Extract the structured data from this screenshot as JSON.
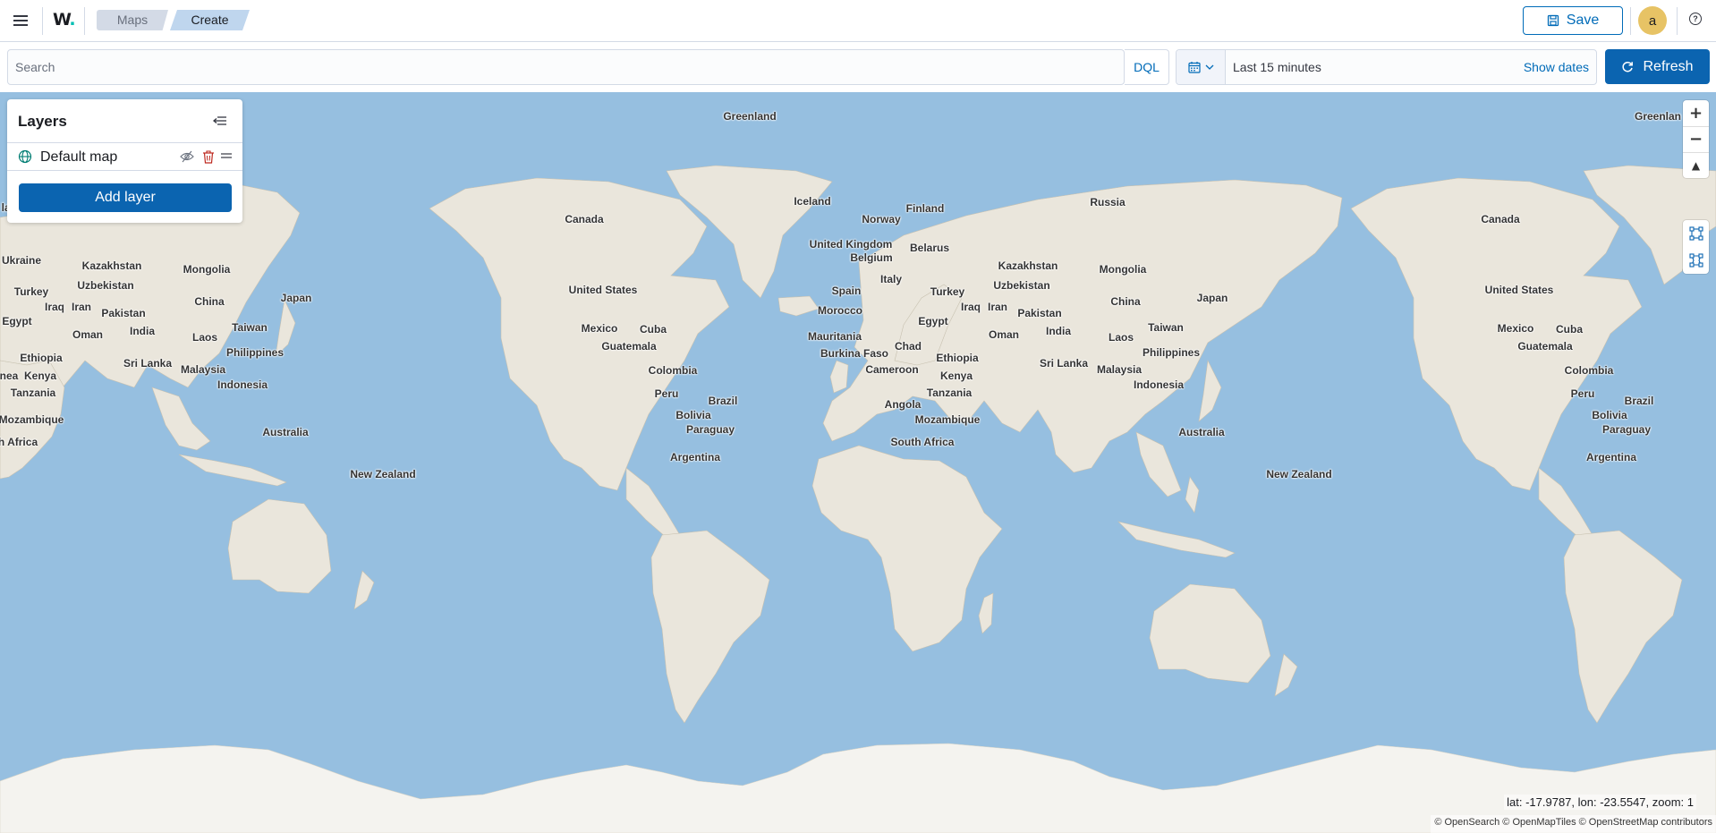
{
  "header": {
    "logo_text": "W",
    "logo_dot": ".",
    "breadcrumbs": [
      {
        "label": "Maps"
      },
      {
        "label": "Create"
      }
    ],
    "save_label": "Save",
    "avatar_initial": "a",
    "help_glyph": "?"
  },
  "query": {
    "search_placeholder": "Search",
    "language_label": "DQL",
    "time_range": "Last 15 minutes",
    "show_dates_label": "Show dates",
    "refresh_label": "Refresh"
  },
  "layers_panel": {
    "title": "Layers",
    "layers": [
      {
        "name": "Default map"
      }
    ],
    "add_layer_label": "Add layer"
  },
  "map": {
    "labels": [
      "Greenland",
      "Greenlan",
      "Iceland",
      "Norway",
      "Finland",
      "Russia",
      "Russia",
      "Canada",
      "Canada",
      "United Kingdom",
      "Belarus",
      "Belgium",
      "Kazakhstan",
      "Kazakhstan",
      "Mongolia",
      "Mongolia",
      "Ukraine",
      "Uzbekistan",
      "Uzbekistan",
      "Turkey",
      "Turkey",
      "Spain",
      "Italy",
      "United States",
      "United States",
      "Japan",
      "Japan",
      "China",
      "China",
      "Iraq",
      "Iraq",
      "Iran",
      "Iran",
      "Pakistan",
      "Pakistan",
      "Egypt",
      "Egypt",
      "Oman",
      "Oman",
      "India",
      "India",
      "Laos",
      "Laos",
      "Taiwan",
      "Taiwan",
      "Morocco",
      "Mauritania",
      "Mexico",
      "Mexico",
      "Cuba",
      "Cuba",
      "Guatemala",
      "Guatemala",
      "Chad",
      "Burkina Faso",
      "Ethiopia",
      "Ethiopia",
      "Philippines",
      "Philippines",
      "Sri Lanka",
      "Sri Lanka",
      "Malaysia",
      "Malaysia",
      "Cameroon",
      "Colombia",
      "Colombia",
      "Kenya",
      "Kenya",
      "Indonesia",
      "Indonesia",
      "Peru",
      "Peru",
      "Brazil",
      "Brazil",
      "Tanzania",
      "Tanzania",
      "Angola",
      "Bolivia",
      "Bolivia",
      "Mozambique",
      "Mozambique",
      "Paraguay",
      "Paraguay",
      "Australia",
      "Australia",
      "South Africa",
      "h Africa",
      "Argentina",
      "Argentina",
      "New Zealand",
      "New Zealand",
      "land",
      "nea"
    ],
    "coordinates_readout": "lat: -17.9787, lon: -23.5547, zoom: 1",
    "attribution": "© OpenSearch © OpenMapTiles © OpenStreetMap contributors",
    "zoom_in_glyph": "+",
    "zoom_out_glyph": "−",
    "compass_glyph": "▲",
    "colors": {
      "ocean": "#96bfe0",
      "land": "#eae6dc",
      "ice": "#f4f3ef",
      "accent": "#0b64b0"
    }
  }
}
